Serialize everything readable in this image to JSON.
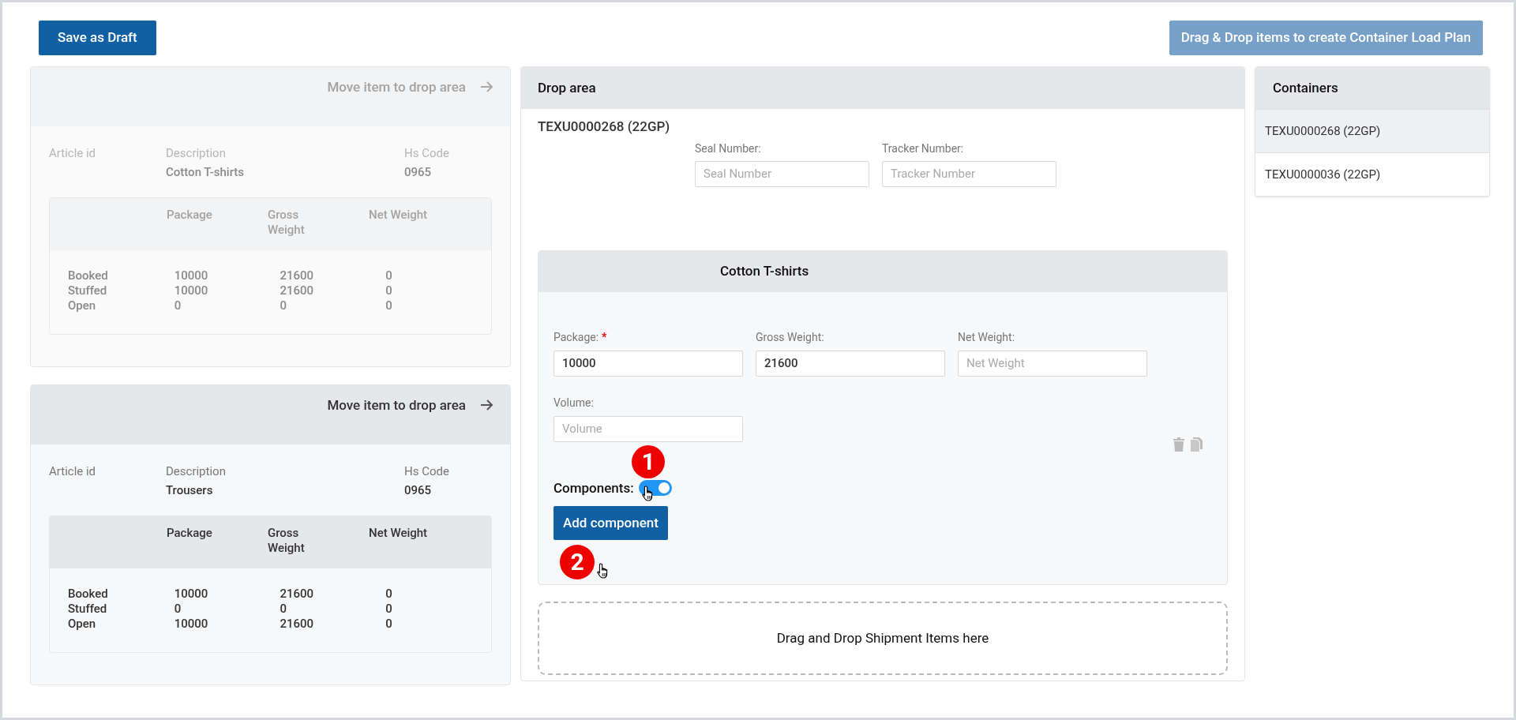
{
  "toolbar": {
    "save_button": "Save as Draft",
    "hint_button": "Drag & Drop items to create Container Load Plan"
  },
  "items": [
    {
      "disabled": true,
      "move_label": "Move item to drop area",
      "article_label": "Article id",
      "description_label": "Description",
      "description": "Cotton T-shirts",
      "hs_label": "Hs Code",
      "hs_code": "0965",
      "columns": [
        "Package",
        "Gross Weight",
        "Net Weight"
      ],
      "rows": [
        {
          "label": "Booked",
          "values": [
            "10000",
            "21600",
            "0"
          ]
        },
        {
          "label": "Stuffed",
          "values": [
            "10000",
            "21600",
            "0"
          ]
        },
        {
          "label": "Open",
          "values": [
            "0",
            "0",
            "0"
          ]
        }
      ]
    },
    {
      "disabled": false,
      "move_label": "Move item to drop area",
      "article_label": "Article id",
      "description_label": "Description",
      "description": "Trousers",
      "hs_label": "Hs Code",
      "hs_code": "0965",
      "columns": [
        "Package",
        "Gross Weight",
        "Net Weight"
      ],
      "rows": [
        {
          "label": "Booked",
          "values": [
            "10000",
            "21600",
            "0"
          ]
        },
        {
          "label": "Stuffed",
          "values": [
            "0",
            "0",
            "0"
          ]
        },
        {
          "label": "Open",
          "values": [
            "10000",
            "21600",
            "0"
          ]
        }
      ]
    }
  ],
  "drop_area": {
    "title": "Drop area",
    "container": "TEXU0000268 (22GP)",
    "container_fields": [
      {
        "label": "Seal Number:",
        "placeholder": "Seal Number"
      },
      {
        "label": "Tracker Number:",
        "placeholder": "Tracker Number"
      }
    ],
    "item": {
      "title": "Cotton T-shirts",
      "fields": [
        {
          "label": "Package:",
          "required_mark": "*",
          "value": "10000"
        },
        {
          "label": "Gross Weight:",
          "value": "21600"
        },
        {
          "label": "Net Weight:",
          "placeholder": "Net Weight"
        },
        {
          "label": "Volume:",
          "placeholder": "Volume"
        }
      ],
      "components_label": "Components:",
      "components_on": true,
      "add_button": "Add component",
      "steps": [
        "1",
        "2"
      ]
    },
    "dropzone": "Drag and Drop Shipment Items here"
  },
  "containers": {
    "title": "Containers",
    "items": [
      {
        "label": "TEXU0000268 (22GP)",
        "selected": true
      },
      {
        "label": "TEXU0000036 (22GP)",
        "selected": false
      }
    ]
  }
}
